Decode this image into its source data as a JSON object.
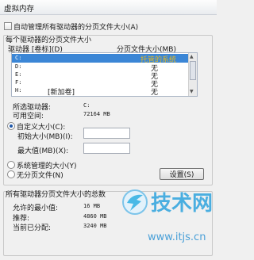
{
  "window": {
    "title": "虚拟内存"
  },
  "auto_manage": {
    "label": "自动管理所有驱动器的分页文件大小(A)",
    "checked": false
  },
  "paging_group": {
    "title": "每个驱动器的分页文件大小",
    "col_drive": "驱动器 [卷标](D)",
    "col_size": "分页文件大小(MB)",
    "rows": [
      {
        "drive": "C:",
        "label": "",
        "size": "托管的系统",
        "selected": true
      },
      {
        "drive": "D:",
        "label": "",
        "size": "无",
        "selected": false
      },
      {
        "drive": "E:",
        "label": "",
        "size": "无",
        "selected": false
      },
      {
        "drive": "F:",
        "label": "",
        "size": "无",
        "selected": false
      },
      {
        "drive": "H:",
        "label": "[新加卷]",
        "size": "无",
        "selected": false
      }
    ]
  },
  "selected_drive": {
    "label": "所选驱动器:",
    "value": "C:"
  },
  "available": {
    "label": "可用空间:",
    "value": "72164 MB"
  },
  "custom_size": {
    "label": "自定义大小(C):",
    "checked": true
  },
  "initial_size": {
    "label": "初始大小(MB)(I):",
    "value": ""
  },
  "max_size": {
    "label": "最大值(MB)(X):",
    "value": ""
  },
  "system_managed": {
    "label": "系统管理的大小(Y)"
  },
  "no_paging": {
    "label": "无分页文件(N)"
  },
  "set_button": {
    "label": "设置(S)"
  },
  "totals_group": {
    "title": "所有驱动器分页文件大小的总数",
    "min_label": "允许的最小值:",
    "min_value": "16 MB",
    "recommended_label": "推荐:",
    "recommended_value": "4860 MB",
    "current_label": "当前已分配:",
    "current_value": "3240 MB"
  },
  "watermark": {
    "text": "技术网",
    "url": "www.itjs.cn"
  }
}
